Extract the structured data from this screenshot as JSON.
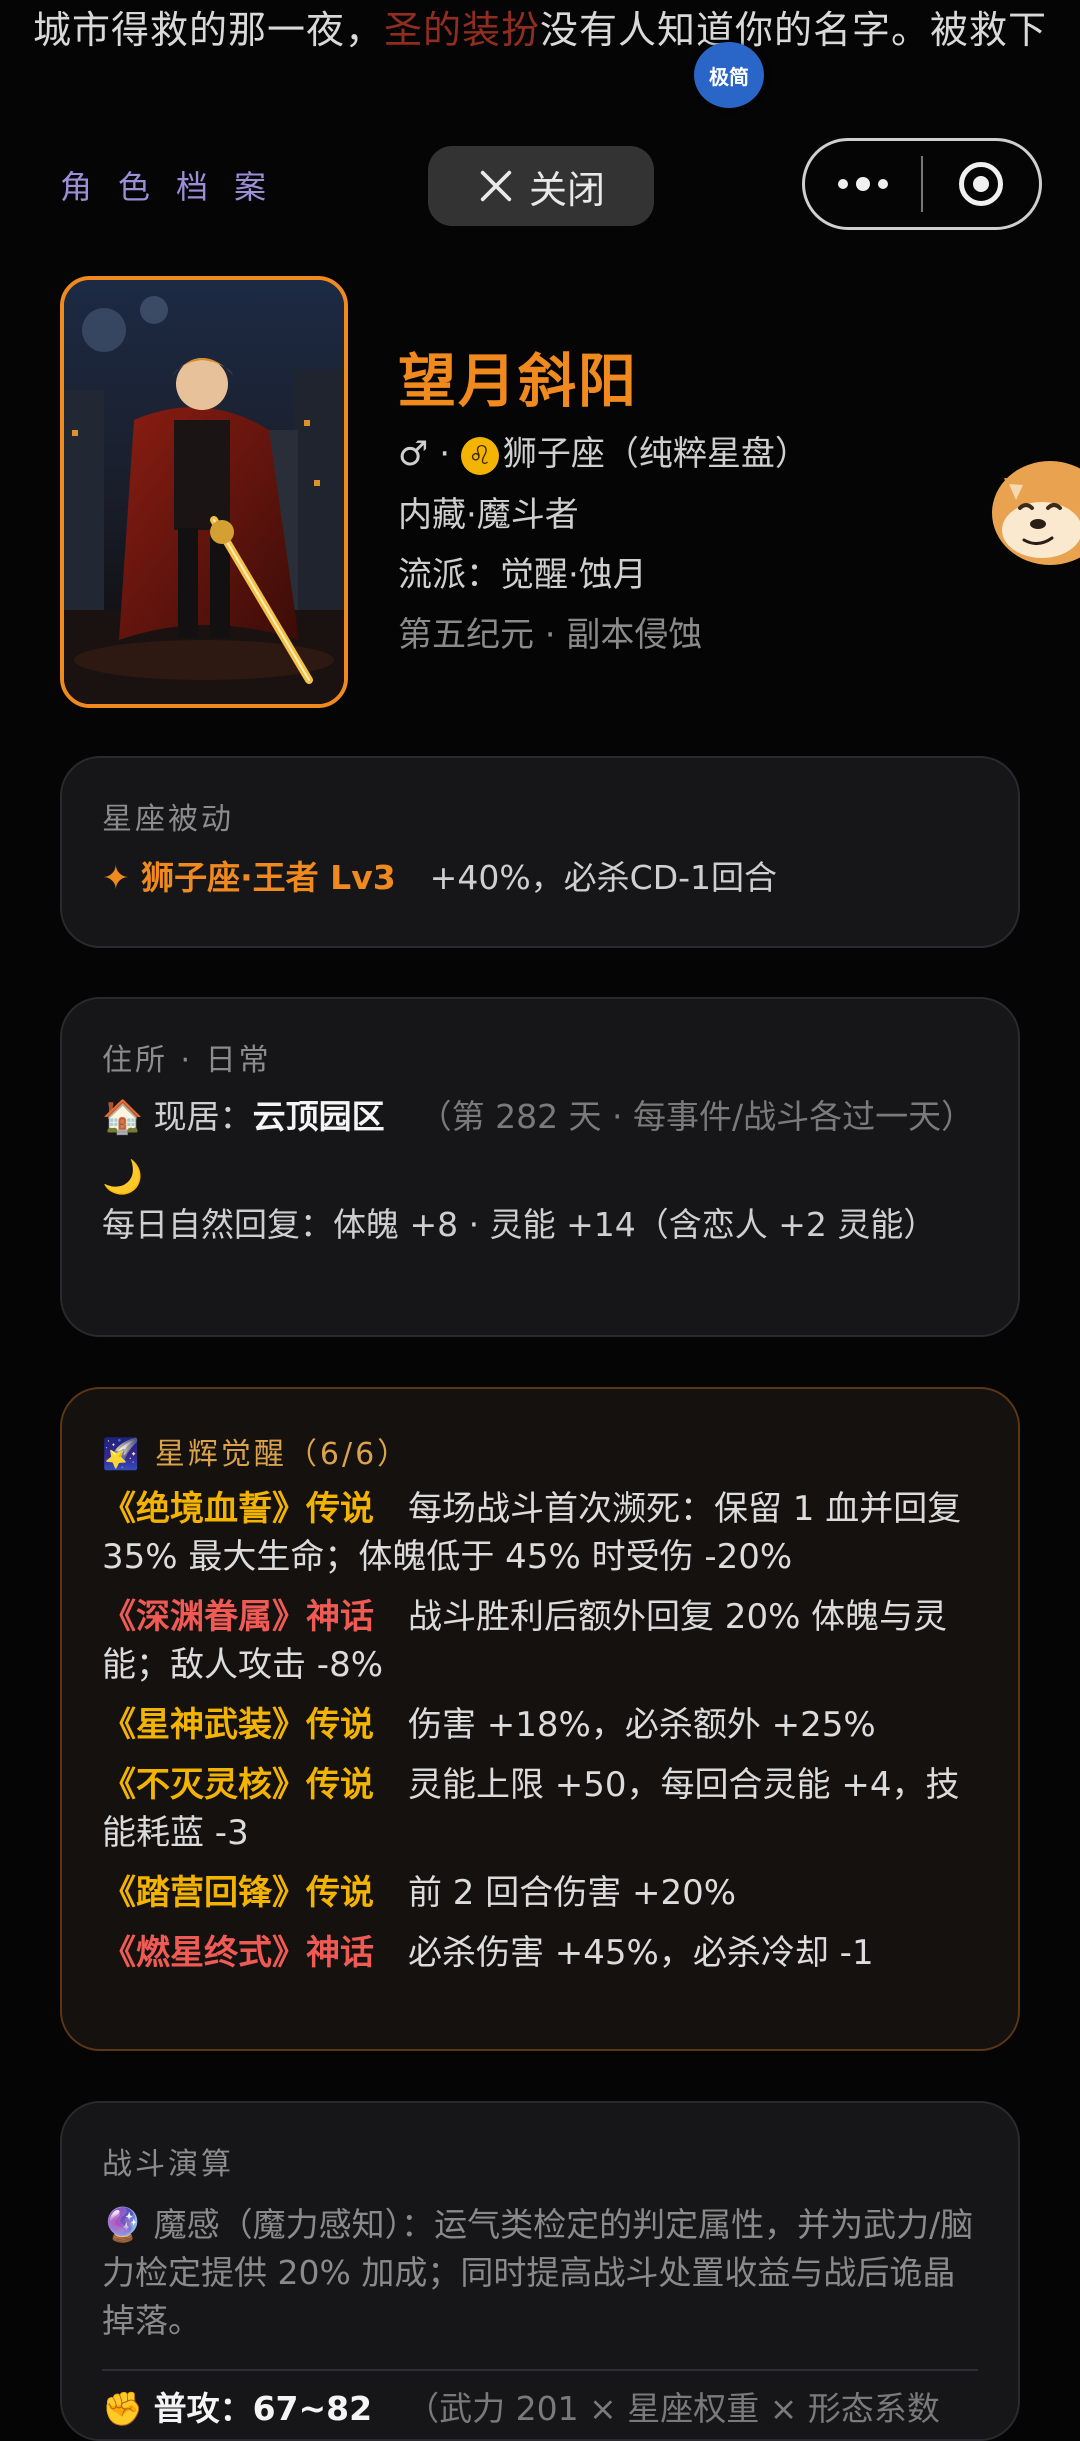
{
  "top_banner": {
    "text_a": "城市得救的那一夜，",
    "text_red": "圣的装扮",
    "text_b": "没有人知道你的名字。被救下"
  },
  "floating_badge": "极简",
  "header": {
    "archive_title": "角色档案",
    "close_label": "关闭"
  },
  "character": {
    "name": "望月斜阳",
    "gender_symbol": "♂",
    "zodiac_icon": "♌",
    "zodiac_text": "狮子座（纯粹星盘）",
    "hidden_class": "内藏·魔斗者",
    "school": "流派：觉醒·蚀月",
    "era": "第五纪元 · 副本侵蚀"
  },
  "passive_card": {
    "title": "星座被动",
    "skill_name": "✦ 狮子座·王者 Lv3",
    "skill_effect": "+40%，必杀CD-1回合"
  },
  "residence_card": {
    "title": "住所 · 日常",
    "house_icon": "🏠",
    "residence_label": "现居：",
    "residence_value": "云顶园区",
    "residence_note": "（第 282 天 · 每事件/战斗各过一天）",
    "moon_icon": "🌙",
    "recovery": "每日自然回复：体魄 +8 · 灵能 +14（含恋人 +2 灵能）"
  },
  "awakening_card": {
    "icon": "🌠",
    "title": "星辉觉醒（6/6）",
    "runes": [
      {
        "name": "《绝境血誓》传说",
        "tier": "legend",
        "effect": "每场战斗首次濒死：保留 1 血并回复 35% 最大生命；体魄低于 45% 时受伤 -20%"
      },
      {
        "name": "《深渊眷属》神话",
        "tier": "myth",
        "effect": "战斗胜利后额外回复 20% 体魄与灵能；敌人攻击 -8%"
      },
      {
        "name": "《星神武装》传说",
        "tier": "legend",
        "effect": "伤害 +18%，必杀额外 +25%"
      },
      {
        "name": "《不灭灵核》传说",
        "tier": "legend",
        "effect": "灵能上限 +50，每回合灵能 +4，技能耗蓝 -3"
      },
      {
        "name": "《踏营回锋》传说",
        "tier": "legend",
        "effect": "前 2 回合伤害 +20%"
      },
      {
        "name": "《燃星终式》神话",
        "tier": "myth",
        "effect": "必杀伤害 +45%，必杀冷却 -1"
      }
    ]
  },
  "battle_card": {
    "title": "战斗演算",
    "orb_icon": "🔮",
    "magic_sense": "魔感（魔力感知）：运气类检定的判定属性，并为武力/脑力检定提供 20% 加成；同时提高战斗处置收益与战后诡晶掉落。",
    "fist_icon": "✊",
    "attack_label": "普攻：",
    "attack_value": "67~82",
    "attack_note": "（武力 201 × 星座权重 × 形态系数"
  },
  "colors": {
    "accent_orange": "#f08a1e",
    "legend_gold": "#f2b400",
    "myth_red": "#ef5a55",
    "archive_purple": "#9d8ed8",
    "badge_blue": "#2a66c7"
  }
}
